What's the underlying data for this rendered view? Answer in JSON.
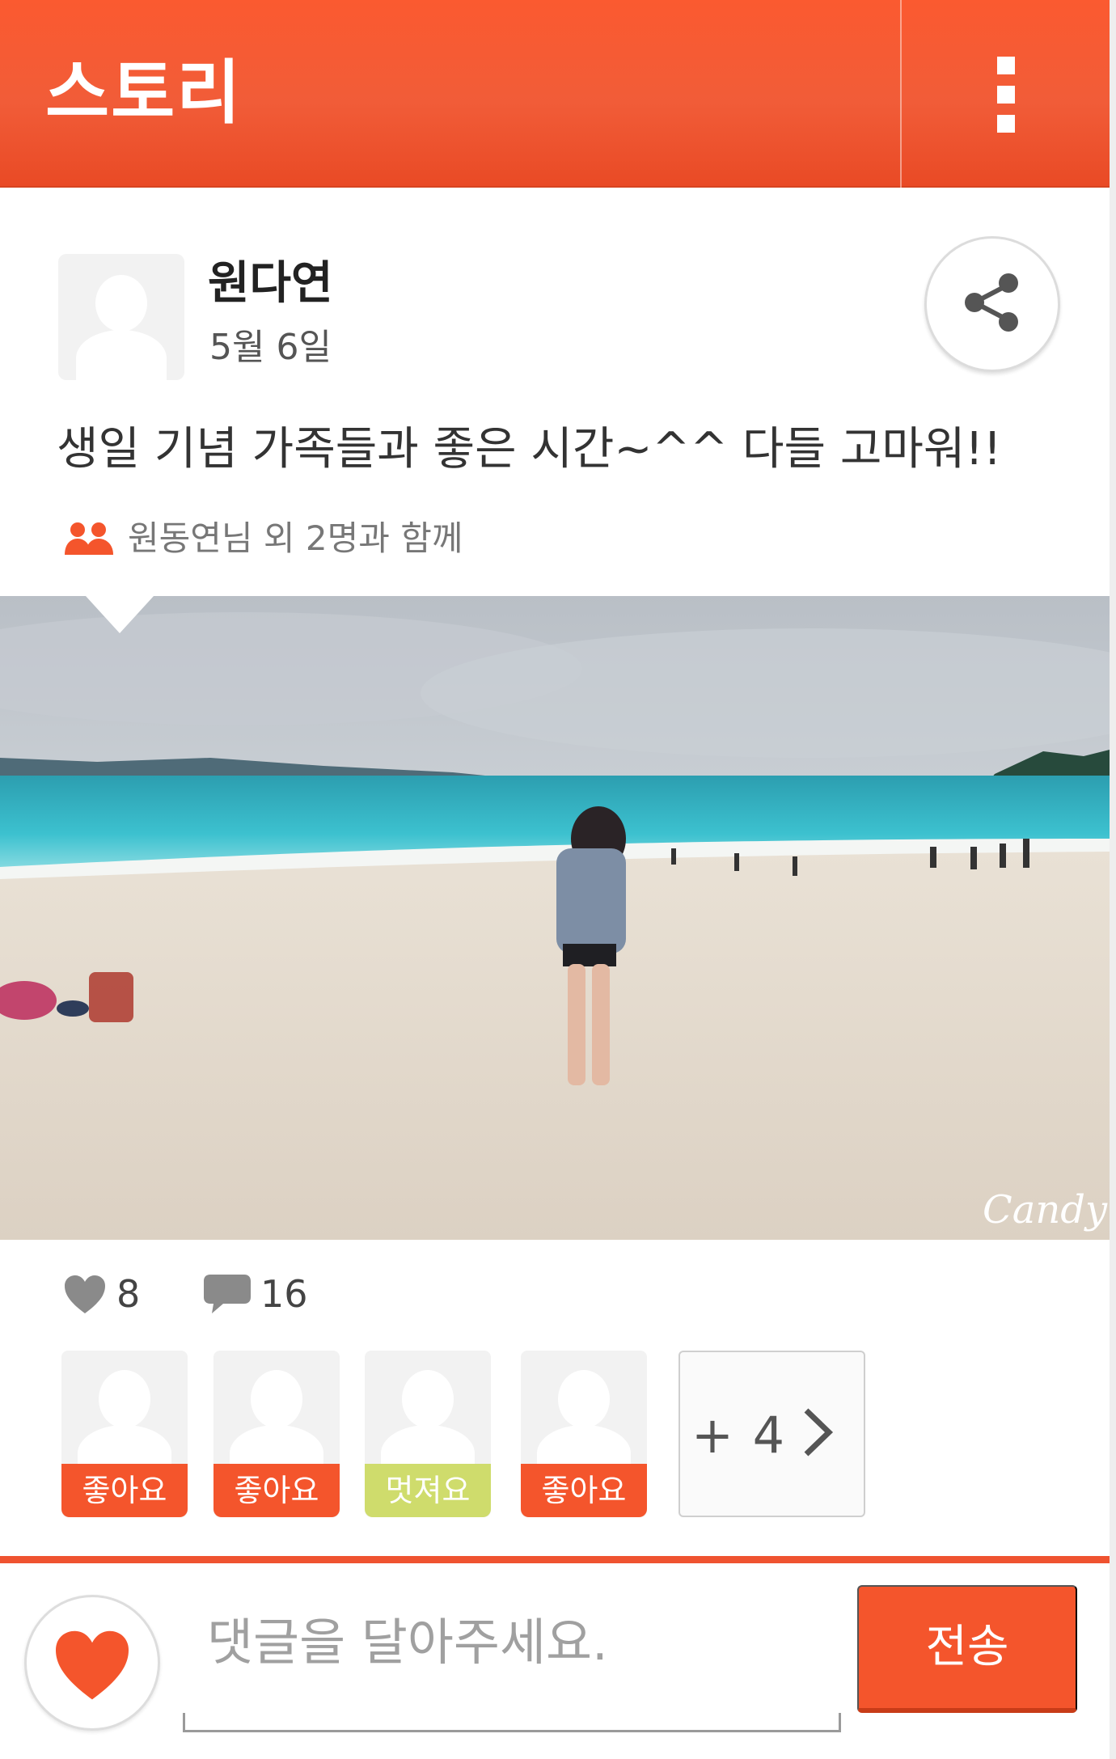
{
  "app_bar": {
    "title": "스토리",
    "menu_icon": "more-vertical-icon"
  },
  "post": {
    "author_name": "원다연",
    "date": "5월 6일",
    "share_icon": "share-icon",
    "text": "생일 기념 가족들과 좋은 시간~^^ 다들 고마워!!",
    "tagged_text": "원동연님 외 2명과 함께",
    "tagged_icon": "people-icon",
    "photo_watermark": "Candy"
  },
  "stats": {
    "likes": "8",
    "comments": "16"
  },
  "reactions": [
    {
      "label": "좋아요",
      "type": "like"
    },
    {
      "label": "좋아요",
      "type": "like"
    },
    {
      "label": "멋져요",
      "type": "cool"
    },
    {
      "label": "좋아요",
      "type": "like"
    }
  ],
  "more_reactions": "+ 4",
  "comment_bar": {
    "placeholder": "댓글을 달아주세요.",
    "send_label": "전송"
  },
  "colors": {
    "accent": "#f4552c",
    "cool_badge": "#cfdc6c",
    "text_dark": "#222222"
  }
}
